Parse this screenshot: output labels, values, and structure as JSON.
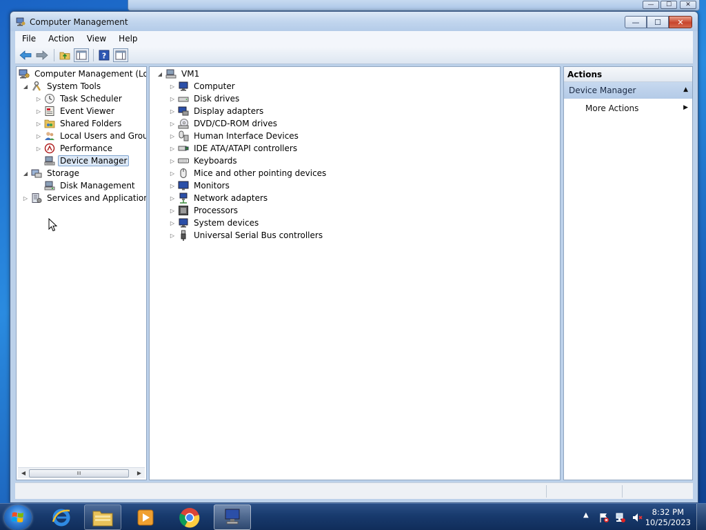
{
  "window": {
    "title": "Computer Management",
    "caption_minimize": "—",
    "caption_maximize": "☐",
    "caption_close": "✕"
  },
  "menu": [
    "File",
    "Action",
    "View",
    "Help"
  ],
  "left_tree": {
    "items": [
      {
        "label": "Computer Management (Local",
        "icon": "computer-management-icon"
      },
      {
        "label": "System Tools",
        "icon": "tools-icon"
      },
      {
        "label": "Task Scheduler",
        "icon": "clock-icon"
      },
      {
        "label": "Event Viewer",
        "icon": "event-viewer-icon"
      },
      {
        "label": "Shared Folders",
        "icon": "shared-folder-icon"
      },
      {
        "label": "Local Users and Groups",
        "icon": "users-icon"
      },
      {
        "label": "Performance",
        "icon": "performance-icon"
      },
      {
        "label": "Device Manager",
        "icon": "device-manager-icon",
        "selected": true
      },
      {
        "label": "Storage",
        "icon": "storage-icon"
      },
      {
        "label": "Disk Management",
        "icon": "disk-management-icon"
      },
      {
        "label": "Services and Applications",
        "icon": "services-icon"
      }
    ],
    "scroll_thumb_grip": "III"
  },
  "device_tree": {
    "root": "VM1",
    "categories": [
      "Computer",
      "Disk drives",
      "Display adapters",
      "DVD/CD-ROM drives",
      "Human Interface Devices",
      "IDE ATA/ATAPI controllers",
      "Keyboards",
      "Mice and other pointing devices",
      "Monitors",
      "Network adapters",
      "Processors",
      "System devices",
      "Universal Serial Bus controllers"
    ]
  },
  "actions": {
    "header": "Actions",
    "section": "Device Manager",
    "more_actions": "More Actions"
  },
  "taskbar": {
    "time": "8:32 PM",
    "date": "10/25/2023",
    "pinned": [
      "internet-explorer-icon",
      "file-explorer-icon",
      "media-player-icon",
      "chrome-icon",
      "computer-management-app-icon"
    ]
  },
  "colors": {
    "selection_bg": "#dce8f6",
    "selection_border": "#7da2ce",
    "taskbar": "#183a6d",
    "close_button": "#c8452c"
  }
}
